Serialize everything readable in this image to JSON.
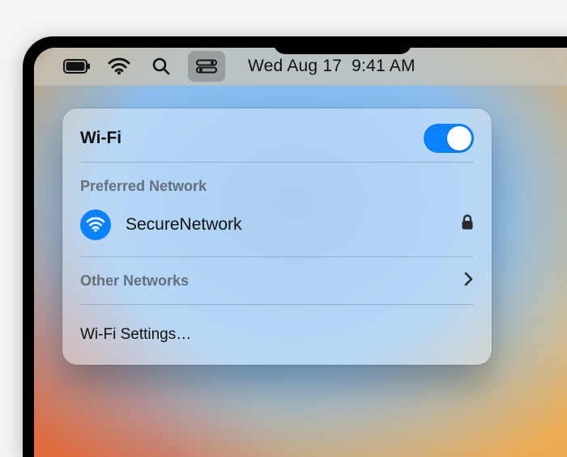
{
  "menubar": {
    "clock_date": "Wed Aug 17",
    "clock_time": "9:41 AM"
  },
  "panel": {
    "title": "Wi-Fi",
    "wifi_enabled": true,
    "preferred_label": "Preferred Network",
    "network_name": "SecureNetwork",
    "other_label": "Other Networks",
    "settings_label": "Wi-Fi Settings…"
  }
}
